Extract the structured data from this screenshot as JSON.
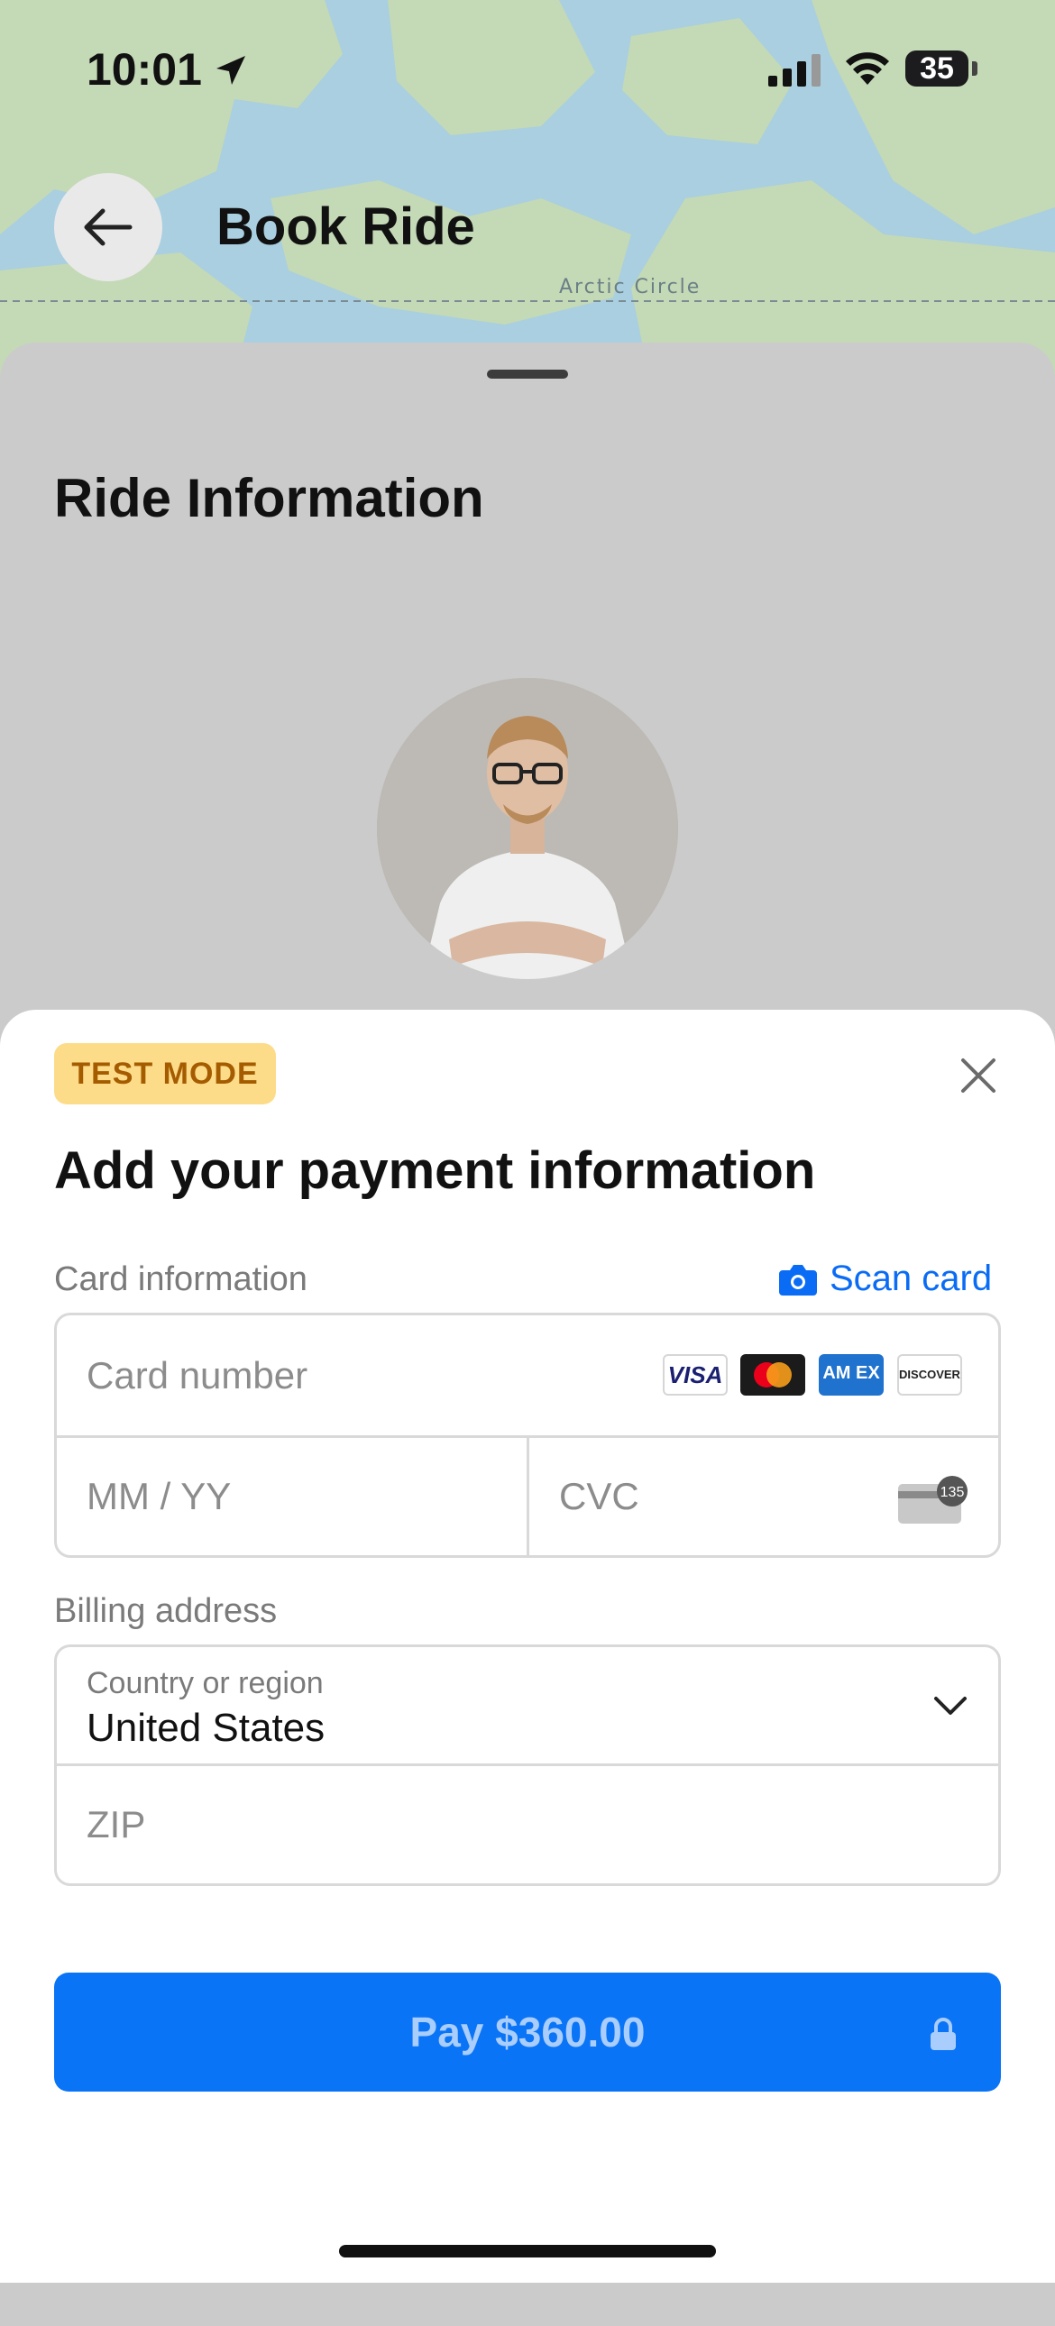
{
  "status_bar": {
    "time": "10:01",
    "battery": "35"
  },
  "map": {
    "arctic_label": "Arctic Circle"
  },
  "header": {
    "title": "Book Ride"
  },
  "sheet": {
    "title": "Ride Information"
  },
  "payment": {
    "badge": "TEST MODE",
    "title": "Add your payment information",
    "card_info_label": "Card information",
    "scan_card": "Scan card",
    "card_number_placeholder": "Card number",
    "expiry_placeholder": "MM / YY",
    "cvc_placeholder": "CVC",
    "cvc_hint": "135",
    "brands": {
      "visa": "VISA",
      "amex": "AM EX",
      "discover": "DISCOVER"
    },
    "billing_label": "Billing address",
    "country_label": "Country or region",
    "country_value": "United States",
    "zip_placeholder": "ZIP",
    "pay_button": "Pay $360.00"
  },
  "colors": {
    "primary": "#0a74f6",
    "badge_bg": "#fddc89",
    "badge_text": "#a55c00"
  }
}
